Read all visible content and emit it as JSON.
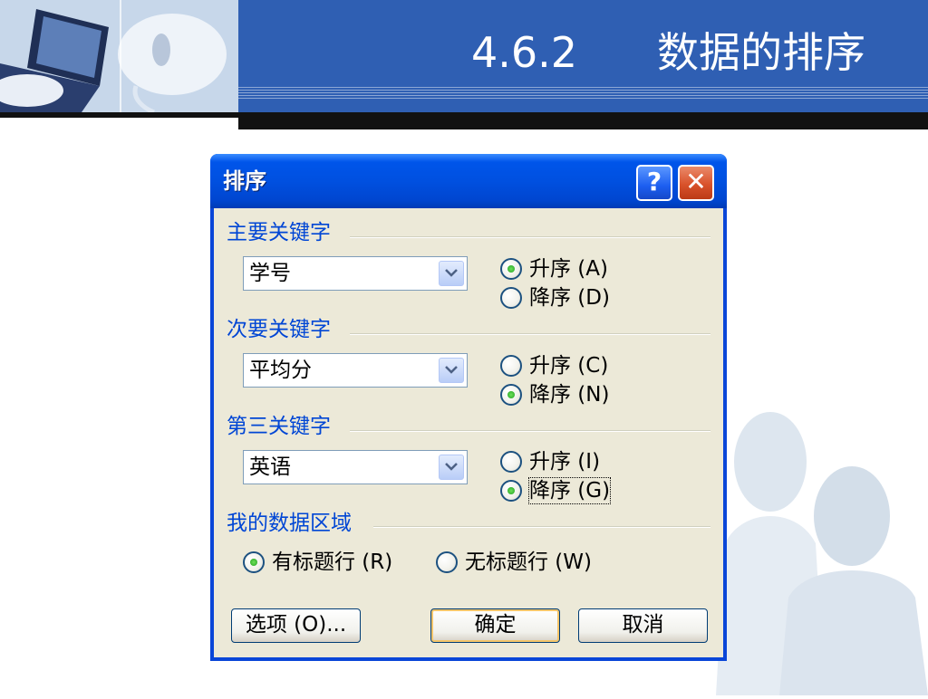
{
  "slide": {
    "section_number": "4.6.2",
    "section_title": "数据的排序"
  },
  "dialog": {
    "title": "排序",
    "help_glyph": "?",
    "close_glyph": "✕",
    "primary": {
      "group_label": "主要关键字",
      "combo_value": "学号",
      "asc_label": "升序 (A)",
      "desc_label": "降序 (D)",
      "selected": "asc"
    },
    "secondary": {
      "group_label": "次要关键字",
      "combo_value": "平均分",
      "asc_label": "升序 (C)",
      "desc_label": "降序 (N)",
      "selected": "desc"
    },
    "tertiary": {
      "group_label": "第三关键字",
      "combo_value": "英语",
      "asc_label": "升序 (I)",
      "desc_label": "降序 (G)",
      "selected": "desc"
    },
    "data_range": {
      "group_label": "我的数据区域",
      "has_header_label": "有标题行 (R)",
      "no_header_label": "无标题行 (W)",
      "selected": "has_header"
    },
    "buttons": {
      "options": "选项 (O)...",
      "ok": "确定",
      "cancel": "取消"
    }
  },
  "colors": {
    "header_band": "#2f5fb3",
    "dialog_title_blue": "#0055ea",
    "group_label_blue": "#0046d5",
    "dialog_face": "#ece9d8"
  }
}
